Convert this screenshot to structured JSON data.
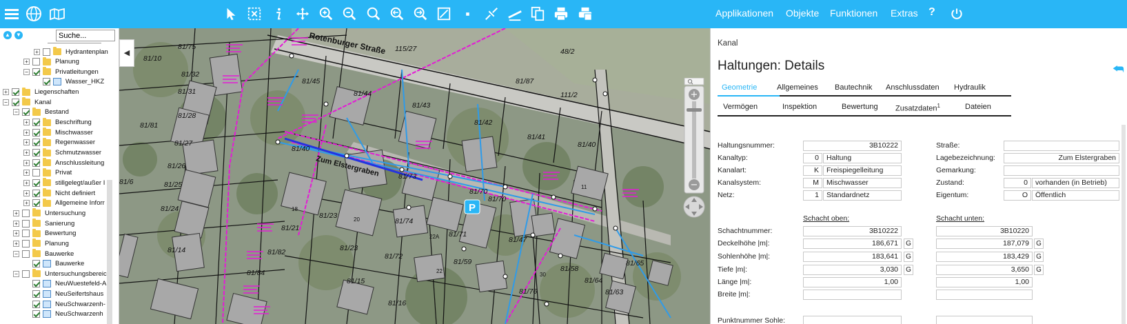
{
  "toolbar": {
    "left_icons": [
      "menu-icon",
      "globe-icon",
      "map-book-icon"
    ],
    "tool_icons": [
      "pointer-icon",
      "select-box-icon",
      "info-icon",
      "pan-icon",
      "zoom-in-icon",
      "zoom-out-icon",
      "zoom-search-icon",
      "zoom-prev-icon",
      "zoom-next-icon",
      "measure-line-icon",
      "point-icon",
      "redline-icon",
      "ruler-icon",
      "copy-icon",
      "print-icon",
      "print-pdf-icon"
    ],
    "menus": [
      "Applikationen",
      "Objekte",
      "Funktionen",
      "Extras"
    ],
    "help_icon": "?",
    "power_icon": "power-icon"
  },
  "tree": {
    "search_value": "Suche...",
    "rows": [
      {
        "label": "Hydrantenplan",
        "indent": 3,
        "expander": "+",
        "checked": false,
        "icon": "folder"
      },
      {
        "label": "Planung",
        "indent": 2,
        "expander": "+",
        "checked": false,
        "icon": "folder"
      },
      {
        "label": "Privatleitungen",
        "indent": 2,
        "expander": "−",
        "checked": true,
        "icon": "folder"
      },
      {
        "label": "Wasser_HKZ",
        "indent": 3,
        "expander": "",
        "checked": true,
        "icon": "layer"
      },
      {
        "label": "Liegenschaften",
        "indent": 0,
        "expander": "+",
        "checked": true,
        "icon": "folder"
      },
      {
        "label": "Kanal",
        "indent": 0,
        "expander": "−",
        "checked": true,
        "icon": "folder"
      },
      {
        "label": "Bestand",
        "indent": 1,
        "expander": "−",
        "checked": true,
        "icon": "folder"
      },
      {
        "label": "Beschriftung",
        "indent": 2,
        "expander": "+",
        "checked": true,
        "icon": "folder"
      },
      {
        "label": "Mischwasser",
        "indent": 2,
        "expander": "+",
        "checked": true,
        "icon": "folder"
      },
      {
        "label": "Regenwasser",
        "indent": 2,
        "expander": "+",
        "checked": true,
        "icon": "folder"
      },
      {
        "label": "Schmutzwasser",
        "indent": 2,
        "expander": "+",
        "checked": true,
        "icon": "folder"
      },
      {
        "label": "Anschlussleitung",
        "indent": 2,
        "expander": "+",
        "checked": true,
        "icon": "folder"
      },
      {
        "label": "Privat",
        "indent": 2,
        "expander": "+",
        "checked": false,
        "icon": "folder"
      },
      {
        "label": "stillgelegt/außer I",
        "indent": 2,
        "expander": "+",
        "checked": true,
        "icon": "folder"
      },
      {
        "label": "Nicht definiert",
        "indent": 2,
        "expander": "+",
        "checked": true,
        "icon": "folder"
      },
      {
        "label": "Allgemeine Inforr",
        "indent": 2,
        "expander": "+",
        "checked": true,
        "icon": "folder"
      },
      {
        "label": "Untersuchung",
        "indent": 1,
        "expander": "+",
        "checked": false,
        "icon": "folder"
      },
      {
        "label": "Sanierung",
        "indent": 1,
        "expander": "+",
        "checked": false,
        "icon": "folder"
      },
      {
        "label": "Bewertung",
        "indent": 1,
        "expander": "+",
        "checked": false,
        "icon": "folder"
      },
      {
        "label": "Planung",
        "indent": 1,
        "expander": "+",
        "checked": false,
        "icon": "folder"
      },
      {
        "label": "Bauwerke",
        "indent": 1,
        "expander": "−",
        "checked": false,
        "icon": "folder"
      },
      {
        "label": "Bauwerke",
        "indent": 2,
        "expander": "",
        "checked": true,
        "icon": "layer"
      },
      {
        "label": "Untersuchungsbereic",
        "indent": 1,
        "expander": "−",
        "checked": false,
        "icon": "folder"
      },
      {
        "label": "NeuWuestefeld-A",
        "indent": 2,
        "expander": "",
        "checked": true,
        "icon": "layer"
      },
      {
        "label": "NeuSeifertshaus",
        "indent": 2,
        "expander": "",
        "checked": true,
        "icon": "layer"
      },
      {
        "label": "NeuSchwarzenh-",
        "indent": 2,
        "expander": "",
        "checked": true,
        "icon": "layer"
      },
      {
        "label": "NeuSchwarzenh",
        "indent": 2,
        "expander": "",
        "checked": true,
        "icon": "layer"
      }
    ]
  },
  "map": {
    "street_labels": [
      "Rotenburger Straße",
      "Zum Elstergraben"
    ],
    "parcel_labels": [
      "81/75",
      "115/27",
      "48/2",
      "81/10",
      "81/32",
      "81/45",
      "81/44",
      "81/87",
      "111/2",
      "81/31",
      "81/43",
      "81/28",
      "81/42",
      "81/41",
      "81/81",
      "81/27",
      "81/40",
      "81/40",
      "81/26",
      "81/25",
      "81/73",
      "81/6",
      "81/24",
      "81/70",
      "81/70",
      "81/74",
      "81/21",
      "81/23",
      "81/71",
      "81/47",
      "81/14",
      "81/82",
      "81/23",
      "81/72",
      "81/59",
      "81/58",
      "81/65",
      "81/84",
      "81/15",
      "81/64",
      "81/63",
      "81/16",
      "81/76"
    ],
    "house_numbers": [
      "18",
      "20",
      "22A",
      "22",
      "11",
      "30"
    ],
    "parking_label": "P",
    "toggle_glyph": "◀"
  },
  "panel": {
    "breadcrumb": "Kanal",
    "title": "Haltungen: Details",
    "back_icon": "back-arrow-icon",
    "tabs_row1": [
      "Geometrie",
      "Allgemeines",
      "Bautechnik",
      "Anschlussdaten",
      "Hydraulik"
    ],
    "tabs_row2": [
      "Vermögen",
      "Inspektion",
      "Bewertung",
      "Zusatzdaten",
      "Dateien"
    ],
    "zusatz_sup": "1",
    "active_tab": "Geometrie",
    "left_fields": [
      {
        "label": "Haltungsnummer:",
        "value": "3B10222"
      },
      {
        "label": "Kanaltyp:",
        "code": "0",
        "value": "Haltung"
      },
      {
        "label": "Kanalart:",
        "code": "K",
        "value": "Freispiegelleitung"
      },
      {
        "label": "Kanalsystem:",
        "code": "M",
        "value": "Mischwasser"
      },
      {
        "label": "Netz:",
        "code": "1",
        "value": "Standardnetz"
      }
    ],
    "right_fields": [
      {
        "label": "Straße:",
        "value": ""
      },
      {
        "label": "Lagebezeichnung:",
        "value": "Zum Elstergraben"
      },
      {
        "label": "Gemarkung:",
        "value": ""
      },
      {
        "label": "Zustand:",
        "code": "0",
        "value": "vorhanden (in Betrieb)"
      },
      {
        "label": "Eigentum:",
        "code": "O",
        "value": "Öffentlich"
      }
    ],
    "schacht_oben": "Schacht oben:",
    "schacht_unten": "Schacht unten:",
    "schacht_rows": [
      {
        "label": "Schachtnummer:",
        "oben": "3B10222",
        "unten": "3B10220",
        "g": false
      },
      {
        "label": "Deckelhöhe |m|:",
        "oben": "186,671",
        "unten": "187,079",
        "g": true
      },
      {
        "label": "Sohlenhöhe |m|:",
        "oben": "183,641",
        "unten": "183,429",
        "g": true
      },
      {
        "label": "Tiefe |m|:",
        "oben": "3,030",
        "unten": "3,650",
        "g": true
      },
      {
        "label": "Länge |m|:",
        "oben": "1,00",
        "unten": "1,00",
        "g": false
      },
      {
        "label": "Breite |m|:",
        "oben": "",
        "unten": "",
        "g": false
      }
    ],
    "punkt_label": "Punktnummer Sohle:",
    "g_label": "G"
  }
}
